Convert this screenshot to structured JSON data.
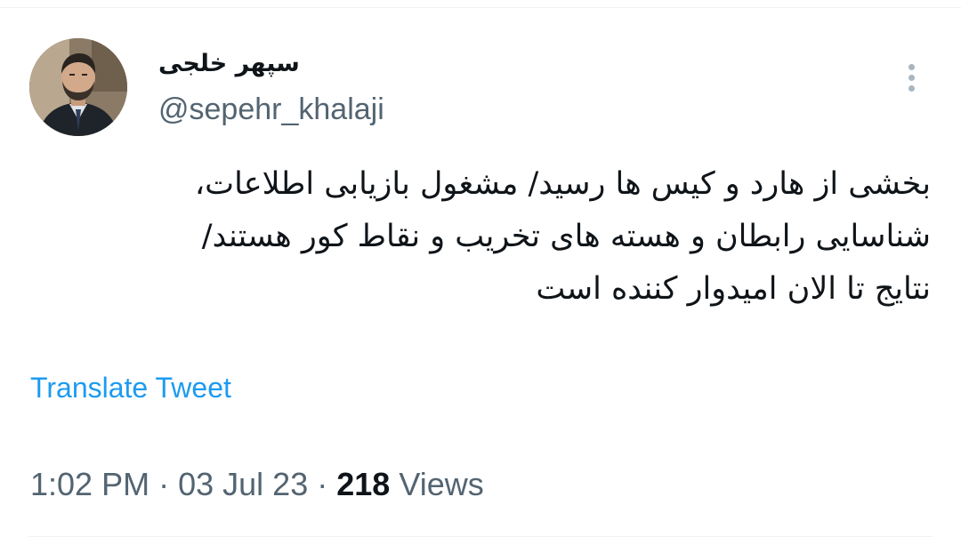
{
  "tweet": {
    "author": {
      "display_name": "سپهر خلجی",
      "handle": "@sepehr_khalaji",
      "avatar_icon": "profile-photo"
    },
    "more_icon": "more-options-icon",
    "text_lines": [
      "بخشی از هارد و کیس ها رسید/ مشغول بازیابی اطلاعات،",
      "شناسایی رابطان و هسته های تخریب و نقاط کور هستند/",
      "نتایج تا الان امیدوار کننده است"
    ],
    "translate_label": "Translate Tweet",
    "time": "1:02 PM",
    "separator": "·",
    "date": "03 Jul 23",
    "views_count": "218",
    "views_label": "Views"
  },
  "colors": {
    "text_primary": "#0f1419",
    "text_secondary": "#536471",
    "link": "#1d9bf0",
    "divider": "#eff3f4"
  }
}
